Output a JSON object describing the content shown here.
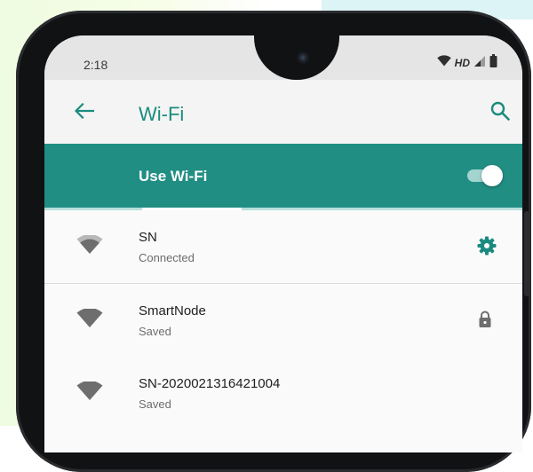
{
  "status_bar": {
    "time": "2:18",
    "network_type": "HD"
  },
  "app_bar": {
    "title": "Wi-Fi",
    "back_icon": "arrow-back-icon",
    "search_icon": "search-icon"
  },
  "master_switch": {
    "label": "Use Wi-Fi",
    "enabled": true
  },
  "networks": [
    {
      "ssid": "SN",
      "status": "Connected",
      "icon": "wifi-signal-icon",
      "action_icon": "gear-icon"
    },
    {
      "ssid": "SmartNode",
      "status": "Saved",
      "icon": "wifi-signal-icon",
      "action_icon": "lock-icon"
    },
    {
      "ssid": "SN-2020021316421004",
      "status": "Saved",
      "icon": "wifi-signal-icon"
    }
  ],
  "colors": {
    "accent": "#1b8b7f",
    "header_band": "#218e84",
    "text_primary": "#1f1f1f",
    "text_secondary": "#6d6d6d"
  }
}
